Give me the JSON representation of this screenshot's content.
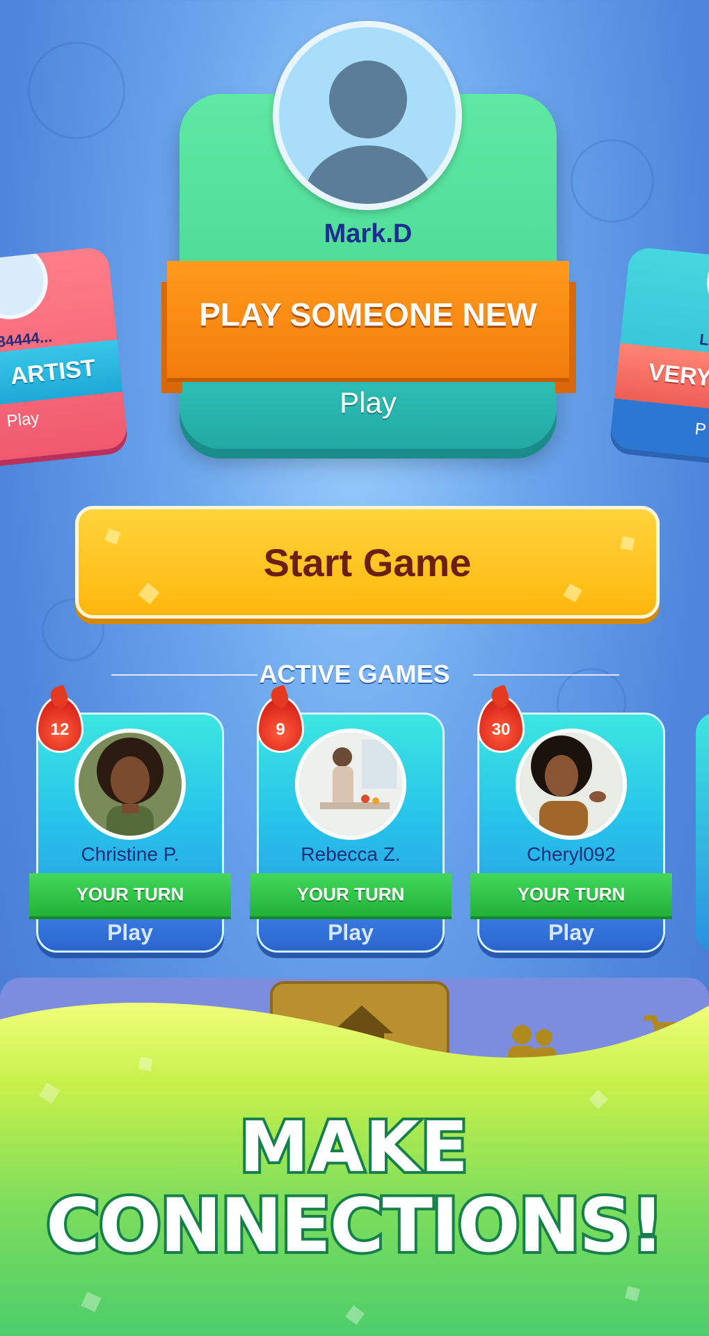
{
  "main_card": {
    "player_name": "Mark.D",
    "banner": "PLAY SOMEONE NEW",
    "play_label": "Play"
  },
  "left_card": {
    "player_name": "84444...",
    "banner": "ARTIST",
    "play_label": "Play"
  },
  "right_card": {
    "player_name": "Le",
    "banner": "VERY",
    "play_label": "P"
  },
  "start_button": "Start Game",
  "active_games": {
    "title": "ACTIVE GAMES",
    "games": [
      {
        "player": "Christine P.",
        "count": "12",
        "status": "YOUR TURN",
        "play": "Play"
      },
      {
        "player": "Rebecca Z.",
        "count": "9",
        "status": "YOUR TURN",
        "play": "Play"
      },
      {
        "player": "Cheryl092",
        "count": "30",
        "status": "YOUR TURN",
        "play": "Play"
      }
    ]
  },
  "nav": {
    "items": [
      {
        "icon": "home-icon"
      },
      {
        "icon": "friends-icon"
      },
      {
        "icon": "cart-icon"
      }
    ]
  },
  "promo": {
    "line1": "MAKE",
    "line2": "CONNECTIONS!"
  },
  "colors": {
    "main_card": "#3fd18a",
    "ribbon": "#f27d0b",
    "start_button": "#ffc21f",
    "turn_band": "#22b13a",
    "promo_text_stroke": "#17804a"
  }
}
